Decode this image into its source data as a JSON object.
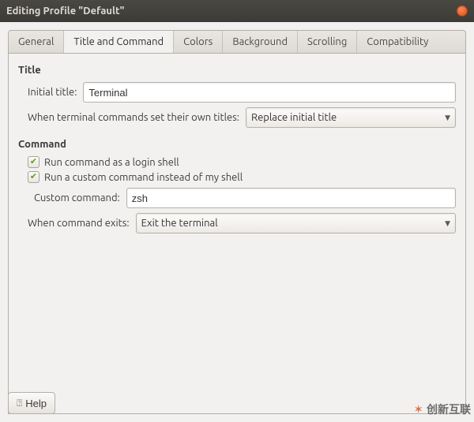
{
  "window": {
    "title": "Editing Profile \"Default\""
  },
  "tabs": [
    {
      "label": "General"
    },
    {
      "label": "Title and Command"
    },
    {
      "label": "Colors"
    },
    {
      "label": "Background"
    },
    {
      "label": "Scrolling"
    },
    {
      "label": "Compatibility"
    }
  ],
  "active_tab_index": 1,
  "title_section": {
    "heading": "Title",
    "initial_title_label": "Initial title:",
    "initial_title_value": "Terminal",
    "own_titles_label": "When terminal commands set their own titles:",
    "own_titles_selected": "Replace initial title"
  },
  "command_section": {
    "heading": "Command",
    "login_shell_label": "Run command as a login shell",
    "login_shell_checked": true,
    "custom_cmd_checkbox_label": "Run a custom command instead of my shell",
    "custom_cmd_checked": true,
    "custom_cmd_label": "Custom command:",
    "custom_cmd_value": "zsh",
    "exit_label": "When command exits:",
    "exit_selected": "Exit the terminal"
  },
  "help_button": "Help",
  "watermark": "创新互联"
}
